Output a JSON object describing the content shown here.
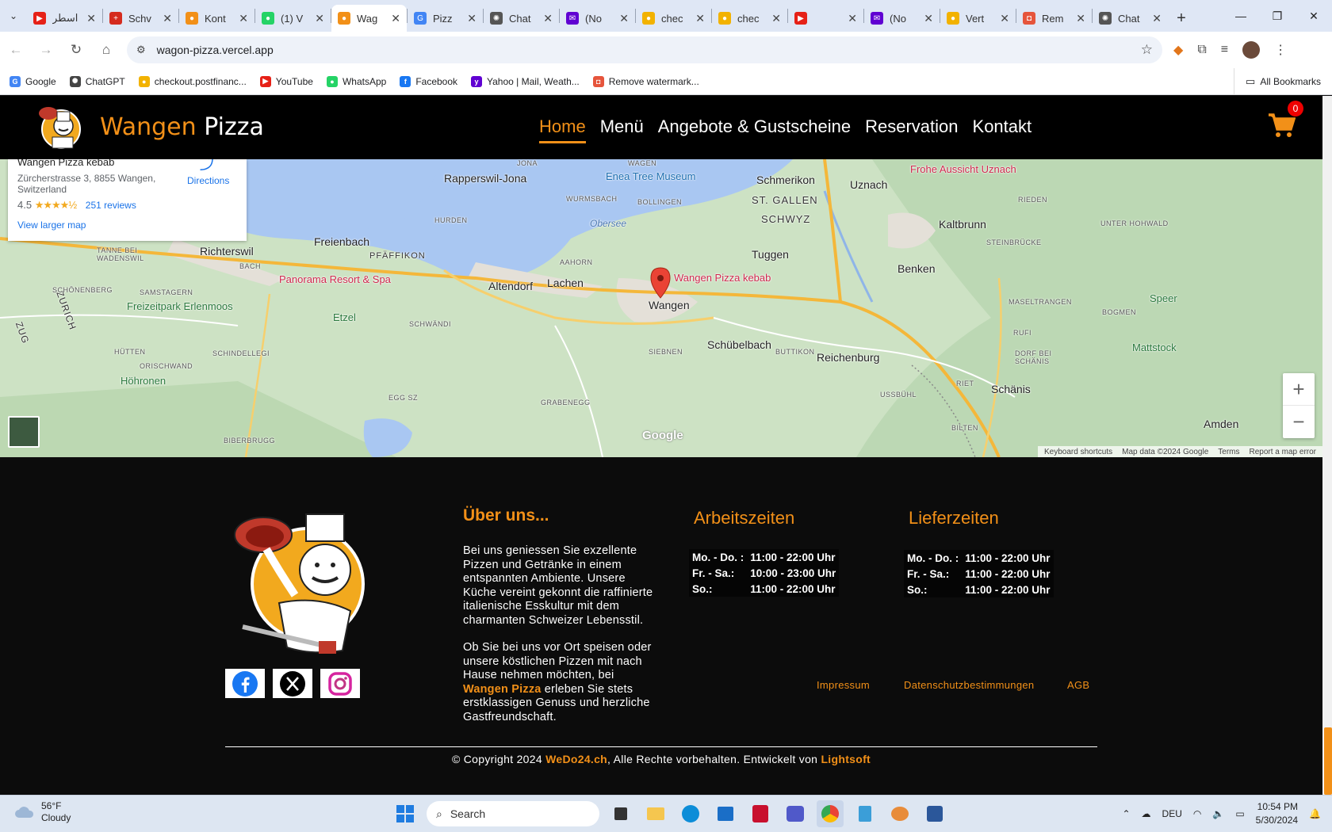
{
  "browser": {
    "tabs": [
      {
        "title": "اسطر",
        "color": "#e62117",
        "glyph": "▶"
      },
      {
        "title": "Schv",
        "color": "#d52b1e",
        "glyph": "+"
      },
      {
        "title": "Kont",
        "color": "#f29018",
        "glyph": "●"
      },
      {
        "title": "(1) V",
        "color": "#25d366",
        "glyph": "●"
      },
      {
        "title": "Wag",
        "color": "#f29018",
        "glyph": "●",
        "active": true
      },
      {
        "title": "Pizz",
        "color": "#4285f4",
        "glyph": "G"
      },
      {
        "title": "Chat",
        "color": "#555555",
        "glyph": "✺"
      },
      {
        "title": "(No",
        "color": "#6001d2",
        "glyph": "✉"
      },
      {
        "title": "chec",
        "color": "#f2b200",
        "glyph": "●"
      },
      {
        "title": "chec",
        "color": "#f2b200",
        "glyph": "●"
      },
      {
        "title": "",
        "color": "#e62117",
        "glyph": "▶"
      },
      {
        "title": "(No",
        "color": "#6001d2",
        "glyph": "✉"
      },
      {
        "title": "Vert",
        "color": "#f2b200",
        "glyph": "●"
      },
      {
        "title": "Rem",
        "color": "#e6553c",
        "glyph": "◘"
      },
      {
        "title": "Chat",
        "color": "#555555",
        "glyph": "✺"
      }
    ],
    "url": "wagon-pizza.vercel.app",
    "bookmarks": [
      {
        "label": "Google",
        "color": "#4285f4",
        "glyph": "G"
      },
      {
        "label": "ChatGPT",
        "color": "#444444",
        "glyph": "✺"
      },
      {
        "label": "checkout.postfinanc...",
        "color": "#f2b200",
        "glyph": "●"
      },
      {
        "label": "YouTube",
        "color": "#e62117",
        "glyph": "▶"
      },
      {
        "label": "WhatsApp",
        "color": "#25d366",
        "glyph": "●"
      },
      {
        "label": "Facebook",
        "color": "#1877f2",
        "glyph": "f"
      },
      {
        "label": "Yahoo | Mail, Weath...",
        "color": "#6001d2",
        "glyph": "y"
      },
      {
        "label": "Remove watermark...",
        "color": "#e6553c",
        "glyph": "◘"
      }
    ],
    "all_bookmarks": "All Bookmarks"
  },
  "site": {
    "brand_first": "Wangen",
    "brand_second": " Pizza",
    "nav": [
      "Home",
      "Menü",
      "Angebote & Gustscheine",
      "Reservation",
      "Kontakt"
    ],
    "cart_count": "0"
  },
  "map": {
    "place_name": "Wangen Pizza kebab",
    "address": "Zürcherstrasse 3, 8855 Wangen, Switzerland",
    "rating": "4.5",
    "stars": "★★★★½",
    "reviews": "251 reviews",
    "larger_map": "View larger map",
    "directions": "Directions",
    "marker_label": "Wangen Pizza kebab",
    "labels": {
      "rapperswil": "Rapperswil-Jona",
      "enea": "Enea Tree Museum",
      "schmerikon": "Schmerikon",
      "uznach": "Uznach",
      "frohe": "Frohe Aussicht Uznach",
      "stgallen": "ST. GALLEN",
      "schwyz": "SCHWYZ",
      "obersee": "Obersee",
      "kaltbrunn": "Kaltbrunn",
      "richterswil": "Richterswil",
      "freienbach": "Freienbach",
      "pfaeffikon": "PFÄFFIKON",
      "panorama": "Panorama Resort & Spa",
      "altendorf": "Altendorf",
      "lachen": "Lachen",
      "tuggen": "Tuggen",
      "benken": "Benken",
      "speer": "Speer",
      "freizeitpark": "Freizeitpark Erlenmoos",
      "etzel": "Etzel",
      "wangen": "Wangen",
      "schuebelbach": "Schübelbach",
      "reichenburg": "Reichenburg",
      "mattstock": "Mattstock",
      "hoehronen": "Höhronen",
      "schaenis": "Schänis",
      "amden": "Amden",
      "zurich": "ZURICH",
      "zug": "ZUG",
      "jona": "JONA",
      "wagen": "WAGEN",
      "wurmsbach": "WURMSBACH",
      "bollingen": "BOLLINGEN",
      "hurden": "HURDEN",
      "riedenl": "RIEDEN",
      "unterhohwald": "UNTER HOHWALD",
      "tanne": "TANNE BEI WADENSWIL",
      "bach": "BACH",
      "aahorn": "AAHORN",
      "steinbruecke": "STEINBRÜCKE",
      "schoenenberg": "SCHÖNENBERG",
      "samstagern": "SAMSTAGERN",
      "maseltrangen": "MASELTRANGEN",
      "schwaendi": "SCHWÄNDI",
      "bogmen": "BOGMEN",
      "rufi": "RUFI",
      "huetten": "HÜTTEN",
      "schindellegi": "SCHINDELLEGI",
      "siebnen": "SIEBNEN",
      "buttikon": "BUTTIKON",
      "dorfbei": "DORF BEI SCHÄNIS",
      "orischwand": "ORISCHWAND",
      "riet": "RIET",
      "eggsz": "EGG SZ",
      "grabenegg": "GRABENEGG",
      "usshuehl": "USSBÜHL",
      "bilten": "BILTEN",
      "biberbrugg": "BIBERBRUGG"
    },
    "google": "Google",
    "attribution": [
      "Keyboard shortcuts",
      "Map data ©2024 Google",
      "Terms",
      "Report a map error"
    ]
  },
  "footer": {
    "about_heading": "Über uns...",
    "about_p1": "Bei uns geniessen Sie exzellente Pizzen und Getränke in einem entspannten Ambiente. Unsere Küche vereint gekonnt die raffinierte italienische Esskultur mit dem charmanten Schweizer Lebensstil.",
    "about_p2a": "Ob Sie bei uns vor Ort speisen oder unsere köstlichen Pizzen mit nach Hause nehmen möchten, bei ",
    "about_p2_hl": "Wangen Pizza",
    "about_p2b": " erleben Sie stets erstklassigen Genuss und herzliche Gastfreundschaft.",
    "work_heading": "Arbeitszeiten",
    "work_hours": [
      {
        "day": "Mo. - Do. :",
        "time": "11:00 - 22:00 Uhr"
      },
      {
        "day": "Fr. - Sa.:",
        "time": "10:00 - 23:00 Uhr"
      },
      {
        "day": "So.:",
        "time": "11:00 - 22:00 Uhr"
      }
    ],
    "delivery_heading": "Lieferzeiten",
    "delivery_hours": [
      {
        "day": "Mo. - Do. :",
        "time": "11:00 - 22:00 Uhr"
      },
      {
        "day": "Fr. - Sa.:",
        "time": "11:00 - 22:00 Uhr"
      },
      {
        "day": "So.:",
        "time": "11:00 - 22:00 Uhr"
      }
    ],
    "links": [
      "Impressum",
      "Datenschutzbestimmungen",
      "AGB"
    ],
    "copy_a": "© Copyright 2024 ",
    "copy_brand": "WeDo24.ch",
    "copy_b": ", Alle Rechte vorbehalten. Entwickelt von ",
    "copy_dev": "Lightsoft"
  },
  "taskbar": {
    "temp": "56°F",
    "weather": "Cloudy",
    "search": "Search",
    "lang": "DEU",
    "time": "10:54 PM",
    "date": "5/30/2024"
  }
}
